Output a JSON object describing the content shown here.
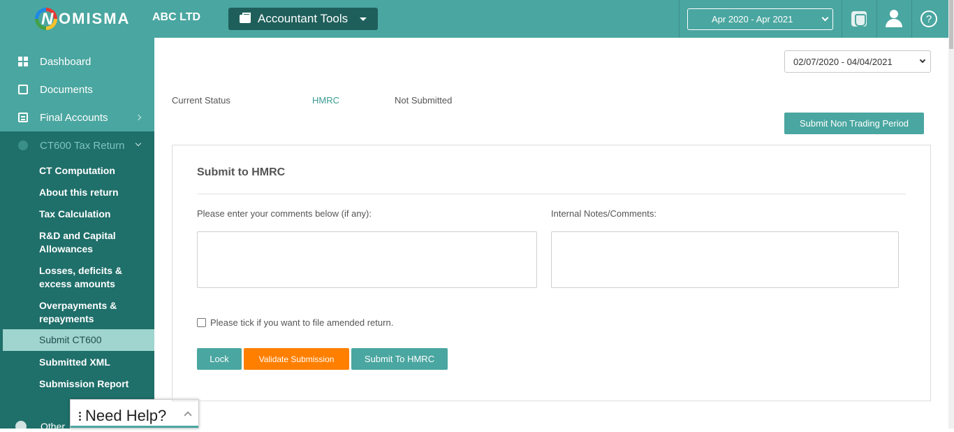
{
  "header": {
    "logo_letter": "N",
    "logo_text": "OMISMA",
    "company": "ABC LTD",
    "tools_label": "Accountant Tools",
    "period": "Apr 2020 - Apr 2021"
  },
  "sidebar": {
    "items": [
      {
        "label": "Dashboard"
      },
      {
        "label": "Documents"
      },
      {
        "label": "Final Accounts"
      },
      {
        "label": "CT600 Tax Return"
      }
    ],
    "ct600_items": [
      {
        "label": "CT Computation"
      },
      {
        "label": "About this return"
      },
      {
        "label": "Tax Calculation"
      },
      {
        "label": "R&D and Capital Allowances"
      },
      {
        "label": "Losses, deficits & excess amounts"
      },
      {
        "label": "Overpayments & repayments"
      },
      {
        "label": "Submit CT600"
      },
      {
        "label": "Submitted XML"
      },
      {
        "label": "Submission Report"
      }
    ],
    "other_label": "Other"
  },
  "need_help": {
    "label": "Need Help?"
  },
  "main": {
    "date_range": "02/07/2020 - 04/04/2021",
    "status_label": "Current Status",
    "status_hmrc": "HMRC",
    "status_value": "Not Submitted",
    "non_trading_button": "Submit Non Trading Period",
    "panel": {
      "title": "Submit to HMRC",
      "comments_label": "Please enter your comments below (if any):",
      "internal_label": "Internal Notes/Comments:",
      "comments_value": "",
      "internal_value": "",
      "amend_label": "Please tick if you want to file amended return.",
      "amend_checked": false,
      "lock_button": "Lock",
      "validate_button": "Validate Submission",
      "submit_button": "Submit To HMRC"
    }
  },
  "colors": {
    "primary": "#4aa6a0",
    "sidebar_dark": "#1f6f6a",
    "orange": "#ff7f00"
  }
}
